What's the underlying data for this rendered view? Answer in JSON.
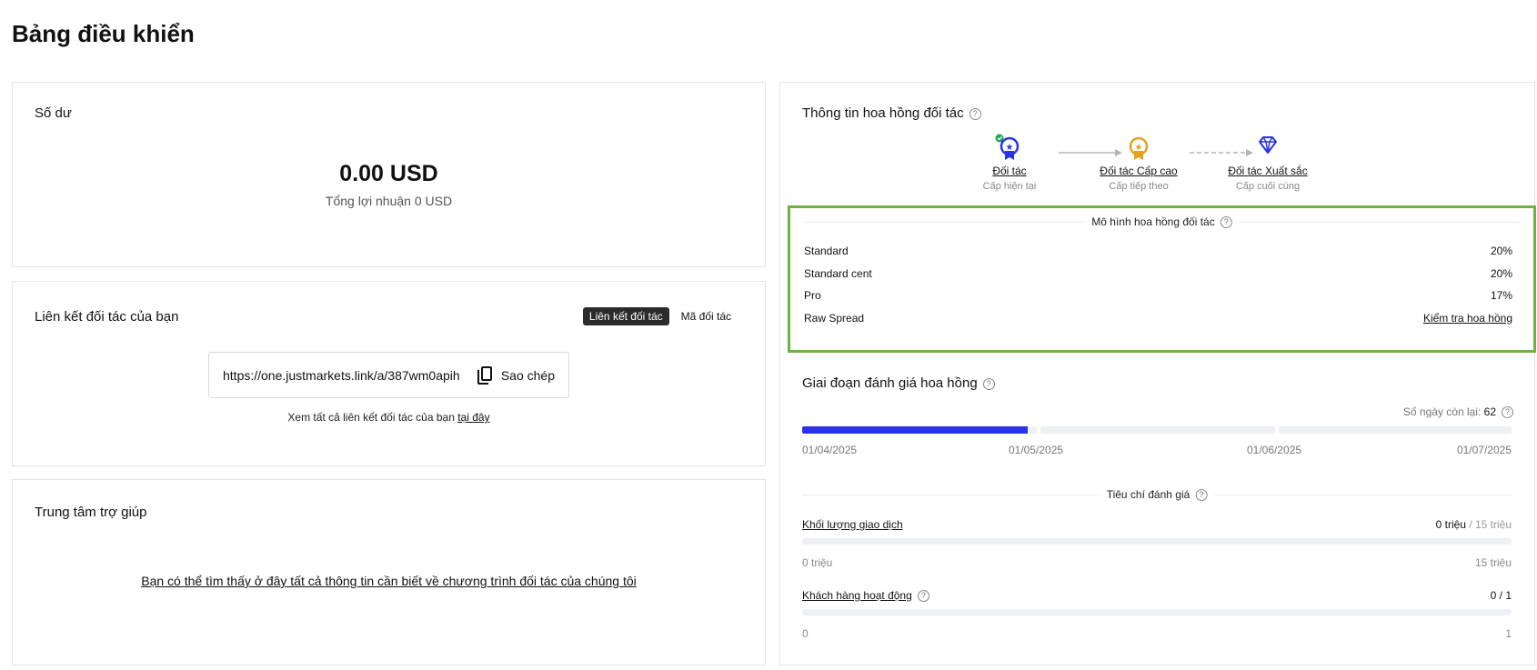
{
  "page": {
    "title": "Bảng điều khiển"
  },
  "balance": {
    "title": "Số dư",
    "amount": "0.00 USD",
    "profit": "Tổng lợi nhuận 0 USD"
  },
  "link": {
    "title": "Liên kết đối tác của bạn",
    "toggle": [
      "Liên kết đối tác",
      "Mã đối tác"
    ],
    "toggle_selected": "Liên kết đối tác",
    "url": "https://one.justmarkets.link/a/387wm0apih",
    "copy_label": "Sao chép",
    "note_prefix": "Xem tất cả liên kết đối tác của bạn",
    "note_link": "tại đây"
  },
  "help": {
    "title": "Trung tâm trợ giúp",
    "link_text": "Bạn có thể tìm thấy ở đây tất cả thông tin cần biết về chương trình đối tác của chúng tôi"
  },
  "commission": {
    "title": "Thông tin hoa hồng đối tác",
    "tiers": [
      {
        "name": "Đối tác",
        "sub": "Cấp hiện tại",
        "color": "#2a33e6",
        "icon": "medal-icon",
        "current": true
      },
      {
        "name": "Đối tác Cấp cao",
        "sub": "Cấp tiếp theo",
        "color": "#e3a21a",
        "icon": "medal-icon"
      },
      {
        "name": "Đối tác Xuất sắc",
        "sub": "Cấp cuối cùng",
        "color": "#2a33e6",
        "icon": "diamond-icon"
      }
    ],
    "model": {
      "title": "Mô hình hoa hồng đối tác",
      "rows": [
        {
          "label": "Standard",
          "value": "20%"
        },
        {
          "label": "Standard cent",
          "value": "20%"
        },
        {
          "label": "Pro",
          "value": "17%"
        },
        {
          "label": "Raw Spread",
          "value": "Kiểm tra hoa hồng"
        }
      ]
    }
  },
  "evaluation": {
    "title": "Giai đoạn đánh giá hoa hồng",
    "days_left_label": "Số ngày còn lại:",
    "days_left": "62",
    "progress_fraction": 0.32,
    "dates": [
      "01/04/2025",
      "01/05/2025",
      "01/06/2025",
      "01/07/2025"
    ],
    "criteria_title": "Tiêu chí đánh giá",
    "criteria": [
      {
        "name": "Khối lượng giao dịch",
        "current": "0 triệu",
        "target": " / 15 triệu",
        "min": "0 triệu",
        "max": "15 triệu"
      },
      {
        "name": "Khách hàng hoạt động",
        "current": "0 / 1",
        "min": "0",
        "max": "1"
      }
    ]
  },
  "colors": {
    "accent": "#2a33e6",
    "highlight_border": "#6db33f",
    "gold": "#e3a21a",
    "check": "#22a35a"
  }
}
